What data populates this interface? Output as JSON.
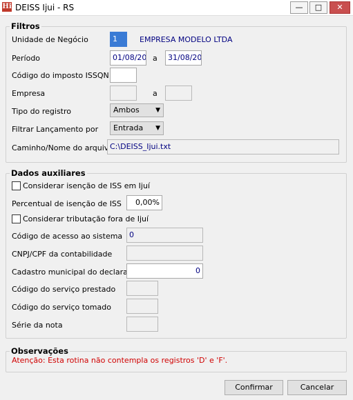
{
  "window": {
    "title": "DEISS Ijui - RS",
    "app_icon": "Hi"
  },
  "filtros": {
    "title": "Filtros",
    "unidade_label": "Unidade de Negócio",
    "unidade_value": "1",
    "empresa_nome": "EMPRESA MODELO LTDA",
    "periodo_label": "Período",
    "periodo_inicio": "01/08/20",
    "periodo_sep": "a",
    "periodo_fim": "31/08/20",
    "codigo_issqn_label": "Código do imposto ISSQN",
    "codigo_issqn_value": "",
    "empresa_label": "Empresa",
    "empresa_sep": "a",
    "tipo_registro_label": "Tipo do registro",
    "tipo_registro_value": "Ambos",
    "filtrar_label": "Filtrar Lançamento por",
    "filtrar_value": "Entrada",
    "caminho_label": "Caminho/Nome do arquivo",
    "caminho_value": "C:\\DEISS_Ijui.txt"
  },
  "dados": {
    "title": "Dados auxiliares",
    "isencao_check_label": "Considerar isenção de ISS em Ijuí",
    "percentual_label": "Percentual de isenção de ISS",
    "percentual_value": "0,00%",
    "tributacao_check_label": "Considerar tributação fora de Ijuí",
    "codigo_acesso_label": "Código de acesso ao sistema",
    "codigo_acesso_value": "0",
    "cnpj_label": "CNPJ/CPF da contabilidade",
    "cnpj_value": "",
    "cadastro_label": "Cadastro municipal do declarante",
    "cadastro_value": "0",
    "servico_prestado_label": "Código do serviço prestado",
    "servico_tomado_label": "Código do serviço tomado",
    "serie_label": "Série da nota"
  },
  "observacoes": {
    "title": "Observações",
    "text": "Atenção: Esta rotina não contempla os registros 'D' e 'F'."
  },
  "buttons": {
    "confirmar": "Confirmar",
    "cancelar": "Cancelar"
  }
}
